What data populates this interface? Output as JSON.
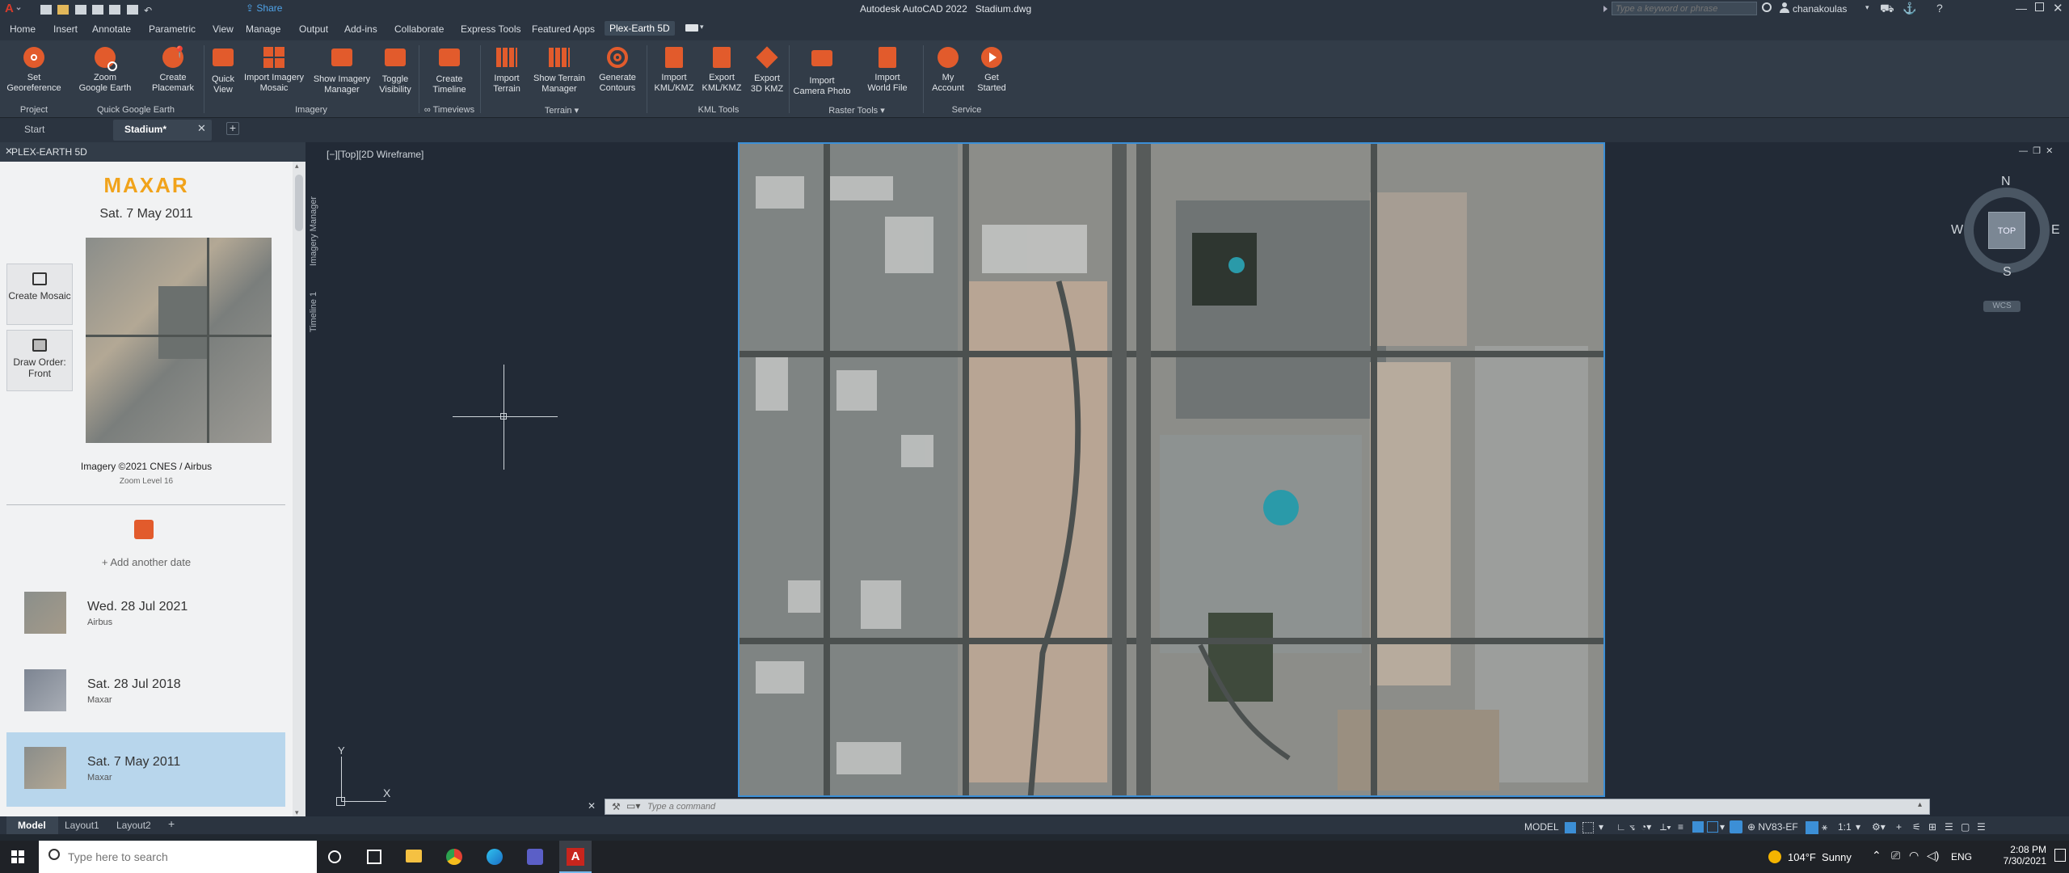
{
  "titlebar": {
    "app_title": "Autodesk AutoCAD 2022",
    "file_name": "Stadium.dwg",
    "share_label": "Share",
    "search_placeholder": "Type a keyword or phrase",
    "user_name": "chanakoulas"
  },
  "menu": [
    "Home",
    "Insert",
    "Annotate",
    "Parametric",
    "View",
    "Manage",
    "Output",
    "Add-ins",
    "Collaborate",
    "Express Tools",
    "Featured Apps",
    "Plex-Earth 5D"
  ],
  "active_menu": "Plex-Earth 5D",
  "ribbon": {
    "buttons": [
      {
        "label1": "Set",
        "label2": "Georeference",
        "icon": "georeference-icon"
      },
      {
        "label1": "Zoom",
        "label2": "Google Earth",
        "icon": "zoom-google-earth-icon"
      },
      {
        "label1": "Create",
        "label2": "Placemark",
        "icon": "placemark-icon"
      },
      {
        "label1": "Quick",
        "label2": "View",
        "icon": "quick-view-icon"
      },
      {
        "label1": "Import Imagery",
        "label2": "Mosaic",
        "icon": "imagery-mosaic-icon"
      },
      {
        "label1": "Show Imagery",
        "label2": "Manager",
        "icon": "imagery-manager-icon"
      },
      {
        "label1": "Toggle",
        "label2": "Visibility",
        "icon": "toggle-visibility-icon"
      },
      {
        "label1": "Create",
        "label2": "Timeline",
        "icon": "timeline-icon"
      },
      {
        "label1": "Import",
        "label2": "Terrain",
        "icon": "import-terrain-icon"
      },
      {
        "label1": "Show Terrain",
        "label2": "Manager",
        "icon": "terrain-manager-icon"
      },
      {
        "label1": "Generate",
        "label2": "Contours",
        "icon": "contours-icon"
      },
      {
        "label1": "Import",
        "label2": "KML/KMZ",
        "icon": "import-kml-icon"
      },
      {
        "label1": "Export",
        "label2": "KML/KMZ",
        "icon": "export-kml-icon"
      },
      {
        "label1": "Export",
        "label2": "3D KMZ",
        "icon": "export-3d-kmz-icon"
      },
      {
        "label1": "Import",
        "label2": "Camera Photo",
        "icon": "camera-photo-icon"
      },
      {
        "label1": "Import",
        "label2": "World File",
        "icon": "world-file-icon"
      },
      {
        "label1": "My",
        "label2": "Account",
        "icon": "account-icon"
      },
      {
        "label1": "Get",
        "label2": "Started",
        "icon": "get-started-icon"
      }
    ],
    "groups": [
      "Project",
      "Quick Google Earth",
      "Imagery",
      "∞ Timeviews",
      "Terrain",
      "KML Tools",
      "Raster Tools",
      "Service"
    ]
  },
  "doc_tabs": {
    "start": "Start",
    "active": "Stadium*"
  },
  "palette": {
    "title": "PLEX-EARTH 5D",
    "brand": "MAXAR",
    "selected_date": "Sat. 7 May 2011",
    "create_mosaic": "Create Mosaic",
    "draw_order": "Draw Order: Front",
    "credit": "Imagery ©2021 CNES / Airbus",
    "zoom_level": "Zoom Level 16",
    "add_date": "+ Add another date",
    "side_tabs": [
      "Imagery Manager",
      "Timeline 1"
    ],
    "history": [
      {
        "date": "Wed. 28 Jul 2021",
        "source": "Airbus"
      },
      {
        "date": "Sat. 28 Jul 2018",
        "source": "Maxar"
      },
      {
        "date": "Sat. 7 May 2011",
        "source": "Maxar"
      }
    ]
  },
  "viewport": {
    "label": "[−][Top][2D Wireframe]",
    "compass": {
      "n": "N",
      "s": "S",
      "e": "E",
      "w": "W",
      "top": "TOP",
      "wcs": "WCS"
    },
    "command_placeholder": "Type a command",
    "ucs_x": "X",
    "ucs_y": "Y"
  },
  "layout_tabs": [
    "Model",
    "Layout1",
    "Layout2"
  ],
  "status": {
    "model": "MODEL",
    "coord_system": "NV83-EF",
    "scale": "1:1"
  },
  "taskbar": {
    "search_placeholder": "Type here to search",
    "weather": "104°F  Sunny",
    "lang": "ENG",
    "time": "2:08 PM",
    "date": "7/30/2021"
  }
}
